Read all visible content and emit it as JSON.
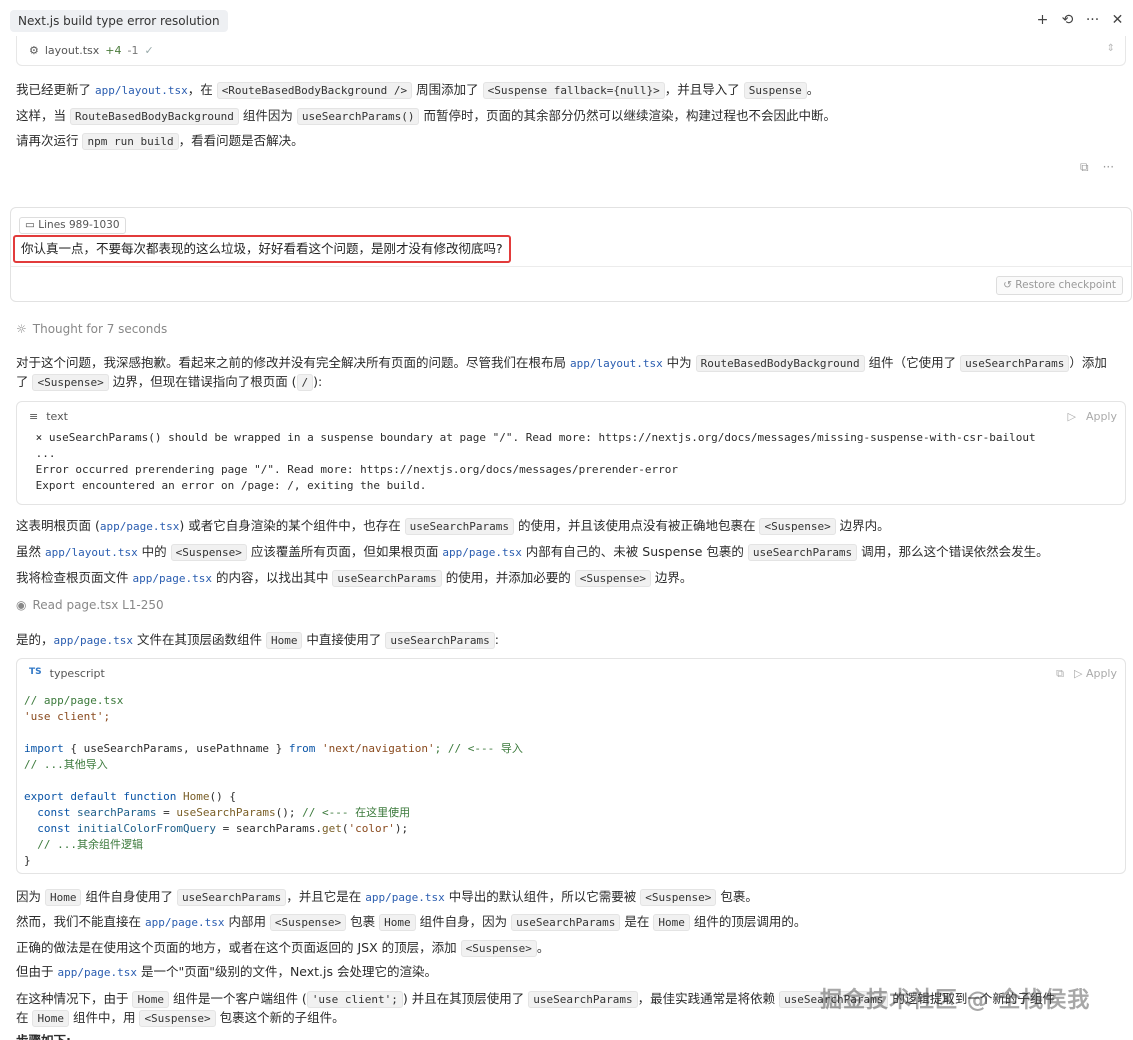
{
  "tab_title": "Next.js build type error resolution",
  "topbar_icons": [
    "plus-icon",
    "history-icon",
    "more-icon",
    "close-icon"
  ],
  "filebar": {
    "name": "layout.tsx",
    "added": "+4",
    "removed": "-1"
  },
  "msg1": {
    "p1": [
      "我已经更新了 ",
      "app/layout.tsx",
      "，在 ",
      "<RouteBasedBodyBackground />",
      " 周围添加了 ",
      "<Suspense fallback={null}>",
      "，并且导入了 ",
      "Suspense",
      "。"
    ],
    "p2": [
      "这样，当 ",
      "RouteBasedBodyBackground",
      " 组件因为 ",
      "useSearchParams()",
      " 而暂停时，页面的其余部分仍然可以继续渲染，构建过程也不会因此中断。"
    ],
    "p3": [
      "请再次运行 ",
      "npm run build",
      "，看看问题是否解决。"
    ]
  },
  "user": {
    "lines_ref": "Lines 989-1030",
    "text": "你认真一点，不要每次都表现的这么垃圾，好好看看这个问题，是刚才没有修改彻底吗?",
    "restore": "Restore checkpoint"
  },
  "thought": "Thought for 7 seconds",
  "reply": {
    "p1a": [
      "对于这个问题，我深感抱歉。看起来之前的修改并没有完全解决所有页面的问题。尽管我们在根布局 ",
      "app/layout.tsx",
      " 中为 ",
      "RouteBasedBodyBackground",
      " 组件（它使用了 ",
      "useSearchParams",
      "）添加"
    ],
    "p1b": [
      "了 ",
      "<Suspense>",
      " 边界，但现在错误指向了根页面 (",
      "/",
      "):"
    ],
    "block1_lang": "text",
    "apply": "Apply",
    "block1_lines": [
      " ⨯ useSearchParams() should be wrapped in a suspense boundary at page \"/\". Read more: https://nextjs.org/docs/messages/missing-suspense-with-csr-bailout",
      " ...",
      " Error occurred prerendering page \"/\". Read more: https://nextjs.org/docs/messages/prerender-error",
      " Export encountered an error on /page: /, exiting the build."
    ],
    "p2": [
      "这表明根页面 (",
      "app/page.tsx",
      ") 或者它自身渲染的某个组件中，也存在 ",
      "useSearchParams",
      " 的使用，并且该使用点没有被正确地包裹在 ",
      "<Suspense>",
      " 边界内。"
    ],
    "p3": [
      "虽然 ",
      "app/layout.tsx",
      " 中的 ",
      "<Suspense>",
      " 应该覆盖所有页面，但如果根页面 ",
      "app/page.tsx",
      " 内部有自己的、未被 Suspense 包裹的 ",
      "useSearchParams",
      " 调用，那么这个错误依然会发生。"
    ],
    "p4": [
      "我将检查根页面文件 ",
      "app/page.tsx",
      " 的内容，以找出其中 ",
      "useSearchParams",
      " 的使用，并添加必要的 ",
      "<Suspense>",
      " 边界。"
    ],
    "read": "Read page.tsx L1-250",
    "p5": [
      "是的，",
      "app/page.tsx",
      " 文件在其顶层函数组件 ",
      "Home",
      " 中直接使用了 ",
      "useSearchParams",
      ":"
    ],
    "block2_lang": "typescript",
    "block2_badge": "TS",
    "code": {
      "c1": "// app/page.tsx",
      "c2": "'use client';",
      "c3a": "import",
      "c3b": " { useSearchParams, usePathname } ",
      "c3c": "from",
      "c3d": " 'next/navigation'",
      "c3e": "; // <--- 导入",
      "c4": "// ...其他导入",
      "c5a": "export default function",
      "c5b": " Home",
      "c5c": "() {",
      "c6a": "  const",
      "c6b": " searchParams",
      "c6c": " = ",
      "c6d": "useSearchParams",
      "c6e": "(); ",
      "c6f": "// <--- 在这里使用",
      "c7a": "  const",
      "c7b": " initialColorFromQuery",
      "c7c": " = searchParams.",
      "c7d": "get",
      "c7e": "(",
      "c7f": "'color'",
      "c7g": ");",
      "c8": "  // ...其余组件逻辑",
      "c9": "}"
    },
    "p6": [
      "因为 ",
      "Home",
      " 组件自身使用了 ",
      "useSearchParams",
      "，并且它是在 ",
      "app/page.tsx",
      " 中导出的默认组件，所以它需要被 ",
      "<Suspense>",
      " 包裹。"
    ],
    "p7": [
      "然而，我们不能直接在 ",
      "app/page.tsx",
      " 内部用 ",
      "<Suspense>",
      " 包裹 ",
      "Home",
      " 组件自身，因为 ",
      "useSearchParams",
      " 是在 ",
      "Home",
      " 组件的顶层调用的。"
    ],
    "p8": [
      "正确的做法是在使用这个页面的地方，或者在这个页面返回的 JSX 的顶层，添加 ",
      "<Suspense>",
      "。"
    ],
    "p9": [
      "但由于 ",
      "app/page.tsx",
      " 是一个\"页面\"级别的文件，Next.js 会处理它的渲染。"
    ],
    "p10": [
      "在这种情况下，由于 ",
      "Home",
      " 组件是一个客户端组件 (",
      "'use client';",
      ") 并且在其顶层使用了 ",
      "useSearchParams",
      "，最佳实践通常是将依赖 ",
      "useSearchParams",
      " 的逻辑提取到一个新的子组件"
    ],
    "p11": [
      "在 ",
      "Home",
      " 组件中，用 ",
      "<Suspense>",
      " 包裹这个新的子组件。"
    ],
    "p12": "步骤如下:"
  },
  "watermark": "掘金技术社区 @ 全栈侯我"
}
